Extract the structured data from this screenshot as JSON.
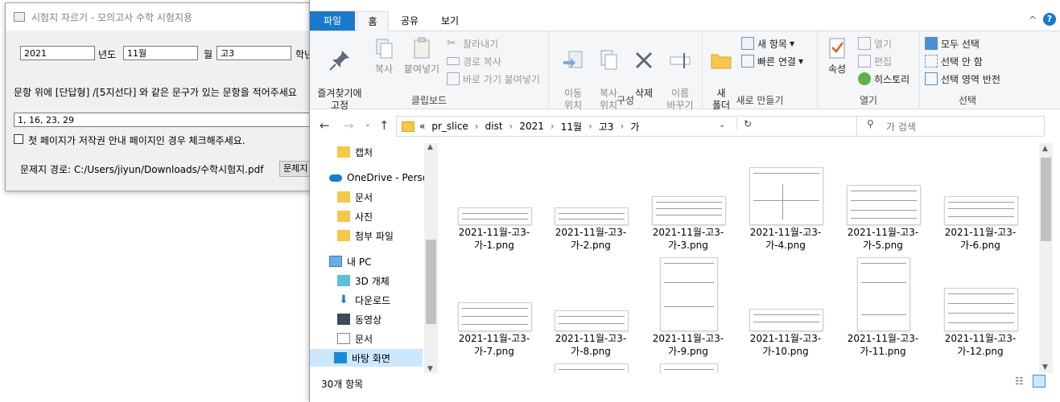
{
  "app_window": {
    "title": "시험지 자르기 - 모의고사 수학 시험지용",
    "year_value": "2021",
    "year_label": "년도",
    "month_value": "11월",
    "month_label": "월",
    "grade_value": "고3",
    "grade_label": "학년",
    "instruction": "문항 위에 [단답형] /[5지선다] 와 같은 문구가 있는 문항을 적어주세요",
    "questions_value": "1, 16, 23, 29",
    "copyright_checkbox_label": "첫 페이지가 저작권 안내 페이지인 경우 체크해주세요.",
    "path_label": "문제지 경로: C:/Users/jiyun/Downloads/수학시험지.pdf",
    "path_button": "문제지"
  },
  "explorer": {
    "tabs": {
      "file": "파일",
      "home": "홈",
      "share": "공유",
      "view": "보기"
    },
    "ribbon": {
      "clipboard": {
        "pin": "즐겨찾기에\n고정",
        "copy": "복사",
        "paste": "붙여넣기",
        "cut": "잘라내기",
        "copy_path": "경로 복사",
        "paste_shortcut": "바로 가기 붙여넣기",
        "label": "클립보드"
      },
      "organize": {
        "move_to": "이동\n위치",
        "copy_to": "복사\n위치",
        "delete": "삭제",
        "rename": "이름\n바꾸기",
        "label": "구성"
      },
      "new": {
        "new_folder": "새\n폴더",
        "new_item": "새 항목",
        "easy_access": "빠른 연결",
        "label": "새로 만들기"
      },
      "open": {
        "properties": "속성",
        "open": "열기",
        "edit": "편집",
        "history": "히스토리",
        "label": "열기"
      },
      "select": {
        "select_all": "모두 선택",
        "select_none": "선택 안 함",
        "invert": "선택 영역 반전",
        "label": "선택"
      }
    },
    "address": {
      "prefix": "«",
      "crumbs": [
        "pr_slice",
        "dist",
        "2021",
        "11월",
        "고3",
        "가"
      ],
      "search_placeholder": "가 검색"
    },
    "nav_items": [
      {
        "label": "캡처",
        "icon": "folder-icon"
      },
      {
        "label": "OneDrive - Person",
        "icon": "onedrive-icon"
      },
      {
        "label": "문서",
        "icon": "folder-icon"
      },
      {
        "label": "사진",
        "icon": "folder-icon"
      },
      {
        "label": "첨부 파일",
        "icon": "folder-icon"
      },
      {
        "label": "내 PC",
        "icon": "pc-icon"
      },
      {
        "label": "3D 개체",
        "icon": "cube-icon"
      },
      {
        "label": "다운로드",
        "icon": "download-icon"
      },
      {
        "label": "동영상",
        "icon": "video-icon"
      },
      {
        "label": "문서",
        "icon": "document-icon"
      },
      {
        "label": "바탕 화면",
        "icon": "desktop-icon"
      }
    ],
    "files": [
      {
        "line1": "2021-11월-고3-",
        "line2": "가-1.png"
      },
      {
        "line1": "2021-11월-고3-",
        "line2": "가-2.png"
      },
      {
        "line1": "2021-11월-고3-",
        "line2": "가-3.png"
      },
      {
        "line1": "2021-11월-고3-",
        "line2": "가-4.png"
      },
      {
        "line1": "2021-11월-고3-",
        "line2": "가-5.png"
      },
      {
        "line1": "2021-11월-고3-",
        "line2": "가-6.png"
      },
      {
        "line1": "2021-11월-고3-",
        "line2": "가-7.png"
      },
      {
        "line1": "2021-11월-고3-",
        "line2": "가-8.png"
      },
      {
        "line1": "2021-11월-고3-",
        "line2": "가-9.png"
      },
      {
        "line1": "2021-11월-고3-",
        "line2": "가-10.png"
      },
      {
        "line1": "2021-11월-고3-",
        "line2": "가-11.png"
      },
      {
        "line1": "2021-11월-고3-",
        "line2": "가-12.png"
      }
    ],
    "status": "30개 항목"
  }
}
